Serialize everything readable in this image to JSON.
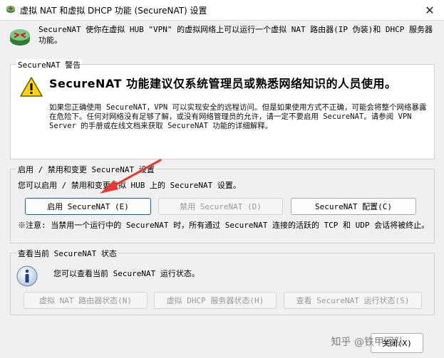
{
  "window": {
    "title": "虚拟 NAT 和虚拟 DHCP 功能 (SecureNAT) 设置",
    "close_glyph": "✕"
  },
  "intro": {
    "text": "SecureNAT 使你在虚拟 HUB \"VPN\" 的虚拟网络上可以运行一个虚拟 NAT 路由器(IP 伪装)和 DHCP 服务器功能。"
  },
  "warning": {
    "group_label": "SecureNAT 警告",
    "heading": "SecureNAT 功能建议仅系统管理员或熟悉网络知识的人员使用。",
    "body": "如果您正确使用 SecureNAT，VPN 可以实现安全的远程访问。但是如果使用方式不正确，可能会将整个网络暴露在危险下。任何对网络没有足够了解，或没有网络管理员的允许，请一定不要启用 SecureNAT。请参阅 VPN Server 的手册或在线文档来获取 SecureNAT 功能的详细解释。"
  },
  "toggle": {
    "group_label": "启用 / 禁用和变更 SecureNAT 设置",
    "description": "您可以启用 / 禁用和变更虚拟 HUB 上的 SecureNAT 设置。",
    "enable_label": "启用 SecureNAT (E)",
    "disable_label": "禁用 SecureNAT (D)",
    "config_label": "SecureNAT 配置(C)",
    "note": "※注意: 当禁用一个运行中的 SecureNAT 时，所有通过 SecureNAT 连接的活跃的 TCP 和 UDP 会话将被终止。"
  },
  "status": {
    "group_label": "查看当前 SecureNAT 状态",
    "description": "您可以查看当前 SecureNAT 运行状态。",
    "nat_status_label": "虚拟 NAT 路由器状态(N)",
    "dhcp_status_label": "虚拟 DHCP 服务器状态(H)",
    "run_status_label": "查看 SecureNAT 运行状态(S)"
  },
  "footer": {
    "close_label": "关闭(X)",
    "watermark": "知乎 @铁甲团队"
  },
  "colors": {
    "accent": "#0067c0",
    "arrow": "#e53935",
    "warning_yellow": "#ffd400"
  }
}
